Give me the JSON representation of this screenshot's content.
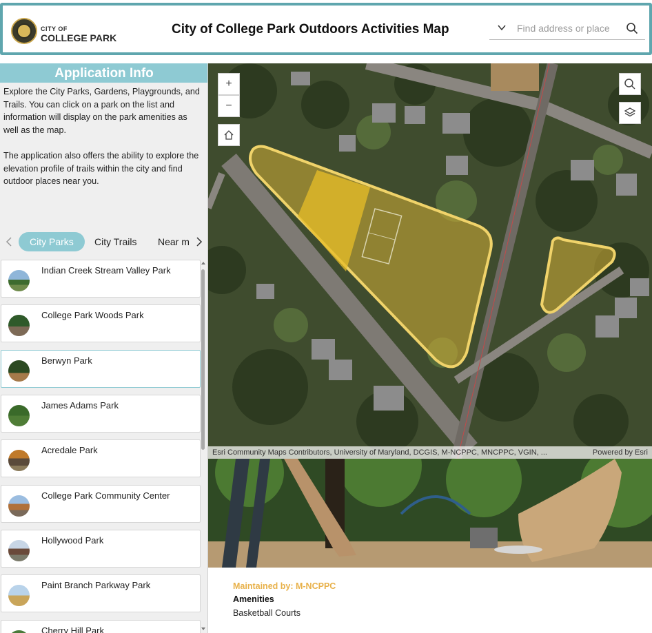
{
  "header": {
    "logo_small": "CITY OF",
    "logo_big": "COLLEGE PARK",
    "title": "City of College Park Outdoors Activities Map",
    "search_placeholder": "Find address or place"
  },
  "info": {
    "title": "Application Info",
    "paragraph1": "Explore the City Parks, Gardens, Playgrounds, and Trails. You can click on a park on the list and information will display on the park amenities as well as the map.",
    "paragraph2": "The application also offers the ability to explore the elevation profile of trails within the city and find outdoor places near you."
  },
  "tabs": [
    "City Parks",
    "City Trails",
    "Near m"
  ],
  "parks": [
    {
      "name": "Indian Creek Stream Valley Park"
    },
    {
      "name": "College Park Woods Park"
    },
    {
      "name": "Berwyn Park"
    },
    {
      "name": "James Adams Park"
    },
    {
      "name": "Acredale Park"
    },
    {
      "name": "College Park Community Center"
    },
    {
      "name": "Hollywood Park"
    },
    {
      "name": "Paint Branch Parkway Park"
    },
    {
      "name": "Cherry Hill Park"
    }
  ],
  "selected_park_index": 2,
  "map": {
    "zoom_in": "+",
    "zoom_out": "−",
    "attribution": "Esri Community Maps Contributors, University of Maryland, DCGIS, M-NCPPC, MNCPPC, VGIN, ...",
    "powered_by": "Powered by Esri"
  },
  "details": {
    "maintained_by": "Maintained by: M-NCPPC",
    "amenities_heading": "Amenities",
    "amenities_value": "Basketball Courts"
  },
  "colors": {
    "header_border": "#5fa6ae",
    "accent": "#8ecad3",
    "park_outline": "#f0d36a",
    "maintained_text": "#e8b14a"
  }
}
